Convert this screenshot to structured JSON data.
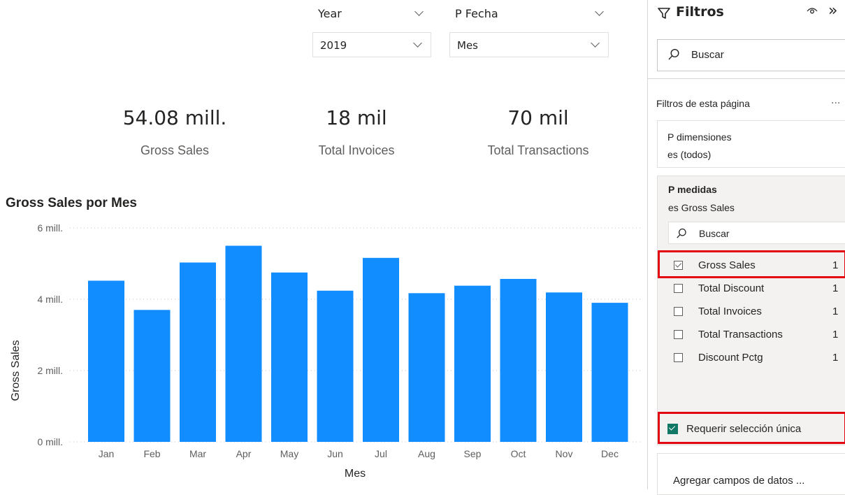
{
  "slicers": {
    "year": {
      "label": "Year",
      "value": "2019"
    },
    "p_fecha": {
      "label": "P Fecha",
      "value": "Mes"
    }
  },
  "cards": [
    {
      "value": "54.08 mill.",
      "label": "Gross Sales"
    },
    {
      "value": "18 mil",
      "label": "Total Invoices"
    },
    {
      "value": "70 mil",
      "label": "Total Transactions"
    }
  ],
  "chart_data": {
    "type": "bar",
    "title": "Gross Sales por Mes",
    "xlabel": "Mes",
    "ylabel": "Gross Sales",
    "categories": [
      "Jan",
      "Feb",
      "Mar",
      "Apr",
      "May",
      "Jun",
      "Jul",
      "Aug",
      "Sep",
      "Oct",
      "Nov",
      "Dec"
    ],
    "values": [
      4.52,
      3.7,
      5.03,
      5.5,
      4.75,
      4.24,
      5.16,
      4.17,
      4.38,
      4.57,
      4.19,
      3.9
    ],
    "yticks": [
      "0 mill.",
      "2 mill.",
      "4 mill.",
      "6 mill."
    ],
    "ylim": [
      0,
      6
    ],
    "grid": true,
    "color": "#118DFF"
  },
  "filters_pane": {
    "title": "Filtros",
    "search_placeholder": "Buscar",
    "section_title": "Filtros de esta página",
    "more": "...",
    "filter1": {
      "name": "P dimensiones",
      "state": "es (todos)"
    },
    "filter2": {
      "name": "P medidas",
      "state": "es Gross Sales",
      "search_placeholder": "Buscar",
      "options": [
        {
          "label": "Gross Sales",
          "count": "1",
          "checked": true
        },
        {
          "label": "Total Discount",
          "count": "1",
          "checked": false
        },
        {
          "label": "Total Invoices",
          "count": "1",
          "checked": false
        },
        {
          "label": "Total Transactions",
          "count": "1",
          "checked": false
        },
        {
          "label": "Discount Pctg",
          "count": "1",
          "checked": false
        }
      ],
      "require_single": "Requerir selección única"
    },
    "add_fields": "Agregar campos de datos ..."
  },
  "colors": {
    "accent": "#118DFF",
    "highlight": "#E30613",
    "check_teal": "#117865"
  }
}
